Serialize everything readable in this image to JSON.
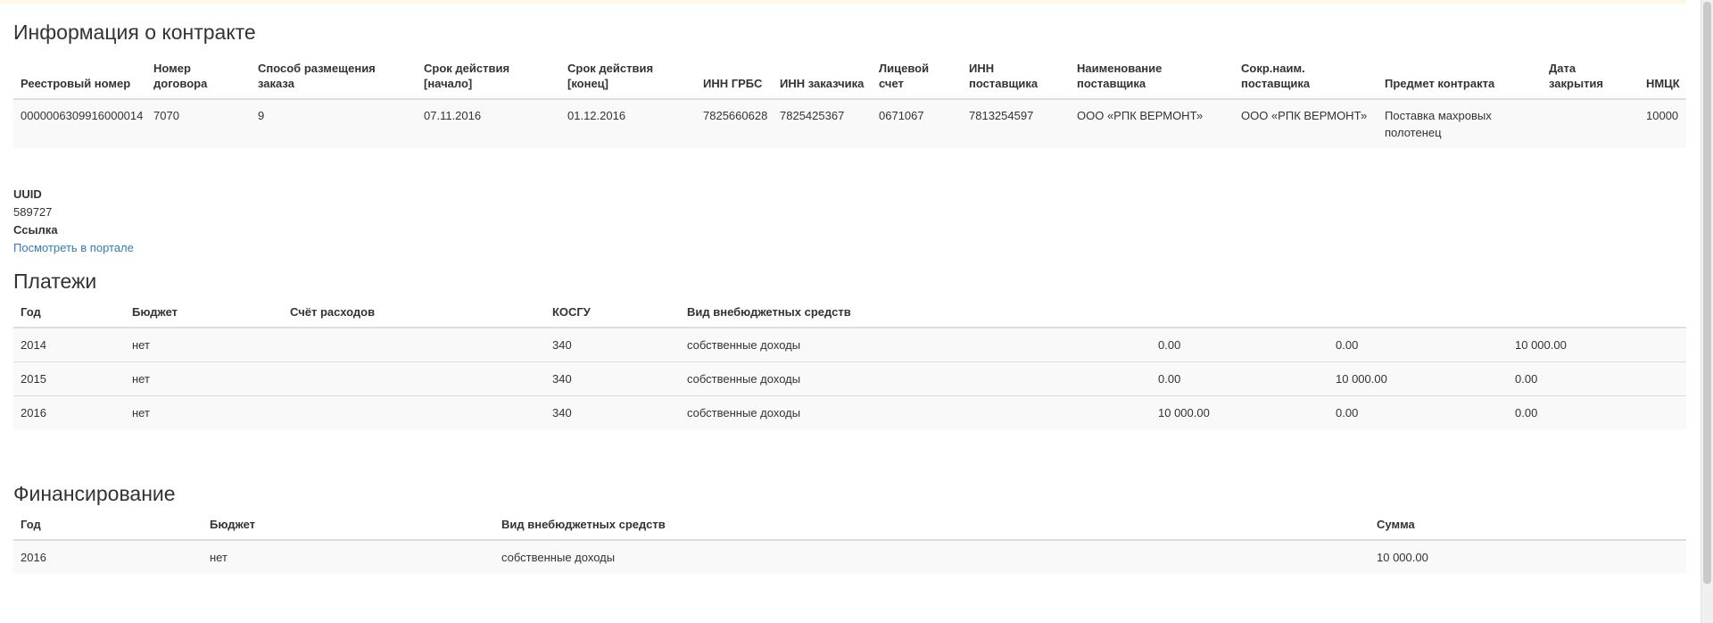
{
  "contract_section": {
    "title": "Информация о контракте",
    "headers": {
      "reg_number": "Реестровый номер",
      "contract_number": "Номер договора",
      "placement_method": "Способ размещения заказа",
      "start_date": "Срок действия [начало]",
      "end_date": "Срок действия [конец]",
      "inn_grbs": "ИНН ГРБС",
      "inn_customer": "ИНН заказчика",
      "account": "Лицевой счет",
      "inn_supplier": "ИНН поставщика",
      "supplier_name": "Наименование поставщика",
      "supplier_short": "Сокр.наим. поставщика",
      "subject": "Предмет контракта",
      "close_date": "Дата закрытия",
      "nmck": "НМЦК"
    },
    "row": {
      "reg_number": "0000006309916000014",
      "contract_number": "7070",
      "placement_method": "9",
      "start_date": "07.11.2016",
      "end_date": "01.12.2016",
      "inn_grbs": "7825660628",
      "inn_customer": "7825425367",
      "account": "0671067",
      "inn_supplier": "7813254597",
      "supplier_name": "ООО «РПК ВЕРМОНТ»",
      "supplier_short": "ООО «РПК ВЕРМОНТ»",
      "subject": "Поставка махровых полотенец",
      "close_date": "",
      "nmck": "10000"
    }
  },
  "info": {
    "uuid_label": "UUID",
    "uuid_value": "589727",
    "link_label": "Ссылка",
    "link_text": "Посмотреть в портале"
  },
  "payments_section": {
    "title": "Платежи",
    "headers": {
      "year": "Год",
      "budget": "Бюджет",
      "expense_account": "Счёт расходов",
      "kosgu": "КОСГУ",
      "funds_type": "Вид внебюджетных средств"
    },
    "rows": [
      {
        "year": "2014",
        "budget": "нет",
        "expense_account": "",
        "kosgu": "340",
        "funds_type": "собственные доходы",
        "sum1": "0.00",
        "sum2": "0.00",
        "sum3": "10 000.00"
      },
      {
        "year": "2015",
        "budget": "нет",
        "expense_account": "",
        "kosgu": "340",
        "funds_type": "собственные доходы",
        "sum1": "0.00",
        "sum2": "10 000.00",
        "sum3": "0.00"
      },
      {
        "year": "2016",
        "budget": "нет",
        "expense_account": "",
        "kosgu": "340",
        "funds_type": "собственные доходы",
        "sum1": "10 000.00",
        "sum2": "0.00",
        "sum3": "0.00"
      }
    ]
  },
  "financing_section": {
    "title": "Финансирование",
    "headers": {
      "year": "Год",
      "budget": "Бюджет",
      "funds_type": "Вид внебюджетных средств",
      "sum": "Сумма"
    },
    "rows": [
      {
        "year": "2016",
        "budget": "нет",
        "funds_type": "собственные доходы",
        "sum": "10 000.00"
      }
    ]
  },
  "colors": {
    "link": "#337ab7",
    "row_bg": "#f9f9f9",
    "border": "#dddddd",
    "top_strip": "#fcf8e3"
  }
}
